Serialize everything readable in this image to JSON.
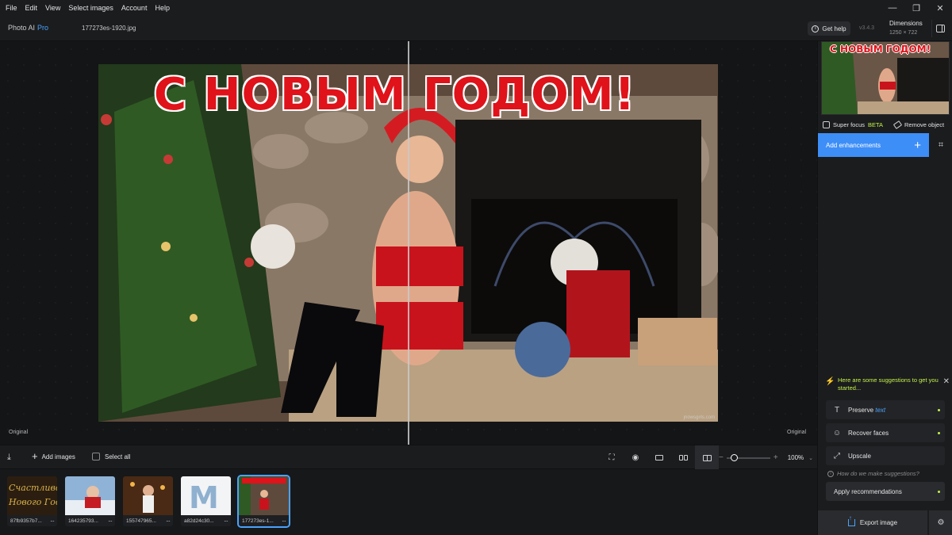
{
  "menu": [
    "File",
    "Edit",
    "View",
    "Select images",
    "Account",
    "Help"
  ],
  "window_controls": {
    "minimize": "—",
    "restore": "❐",
    "close": "✕"
  },
  "header": {
    "app_name": "Photo AI",
    "app_tier": "Pro",
    "filename": "177273es-1920.jpg",
    "get_help": "Get help",
    "version": "v3.4.3",
    "dimensions_label": "Dimensions",
    "dimensions_value": "1250 × 722"
  },
  "canvas": {
    "image_text": "С НОВЫМ ГОДОМ!",
    "watermark": "jnowsgirls.com",
    "label_left": "Original",
    "label_right": "Original"
  },
  "toolbar": {
    "add_images": "Add images",
    "select_all": "Select all",
    "zoom": "100%"
  },
  "filmstrip": [
    {
      "caption": "87fb9357b7...",
      "selected": false
    },
    {
      "caption": "164235793...",
      "selected": false
    },
    {
      "caption": "155747965...",
      "selected": false
    },
    {
      "caption": "a82d24c30...",
      "selected": false
    },
    {
      "caption": "177273es-1...",
      "selected": true
    }
  ],
  "panel": {
    "super_focus": "Super focus",
    "beta": "BETA",
    "remove_object": "Remove object",
    "add_enhancements": "Add enhancements",
    "suggestion_header": "Here are some suggestions to get you started...",
    "suggestions": [
      {
        "label": "Preserve",
        "accent": "text",
        "icon": "text-icon"
      },
      {
        "label": "Recover faces",
        "accent": "",
        "icon": "face-icon"
      },
      {
        "label": "Upscale",
        "accent": "",
        "icon": "upscale-icon"
      }
    ],
    "how_text": "How do we make suggestions?",
    "apply": "Apply recommendations",
    "export": "Export image"
  },
  "colors": {
    "accent_blue": "#3d8ef7",
    "accent_green": "#c4f24a",
    "greeting_red": "#e0121a"
  }
}
